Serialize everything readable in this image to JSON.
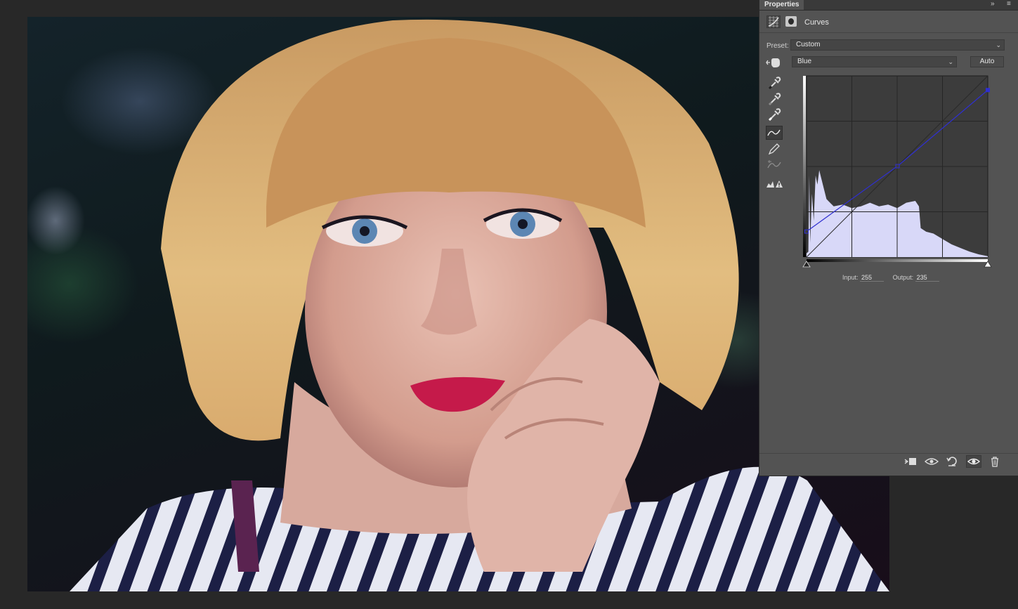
{
  "panel": {
    "tab_title": "Properties",
    "expand_icon": "double-chevron-right-icon",
    "menu_icon": "panel-menu-icon",
    "adjustment_icon": "curves-adjustment-icon",
    "mask_icon": "layer-mask-icon",
    "adjustment_title": "Curves",
    "preset_label": "Preset:",
    "preset_value": "Custom",
    "channel_value": "Blue",
    "auto_label": "Auto",
    "tools": [
      "target-adjustment-hand-icon",
      "black-point-eyedropper-icon",
      "gray-point-eyedropper-icon",
      "white-point-eyedropper-icon",
      "curve-edit-points-icon",
      "pencil-draw-icon",
      "smooth-curve-icon",
      "clipping-warning-icon"
    ],
    "input_label": "Input:",
    "input_value": "255",
    "output_label": "Output:",
    "output_value": "235",
    "footer_icons": [
      "clip-to-layer-icon",
      "view-previous-state-icon",
      "reset-icon",
      "visibility-eye-icon",
      "delete-trash-icon"
    ]
  },
  "curve": {
    "channel_color": "#2f2fd0",
    "histogram_color": "#d8d8f8",
    "grid_divisions": 4,
    "points": [
      [
        0,
        36
      ],
      [
        128,
        128
      ],
      [
        255,
        235
      ]
    ]
  },
  "canvas": {
    "content": "portrait-photo"
  }
}
